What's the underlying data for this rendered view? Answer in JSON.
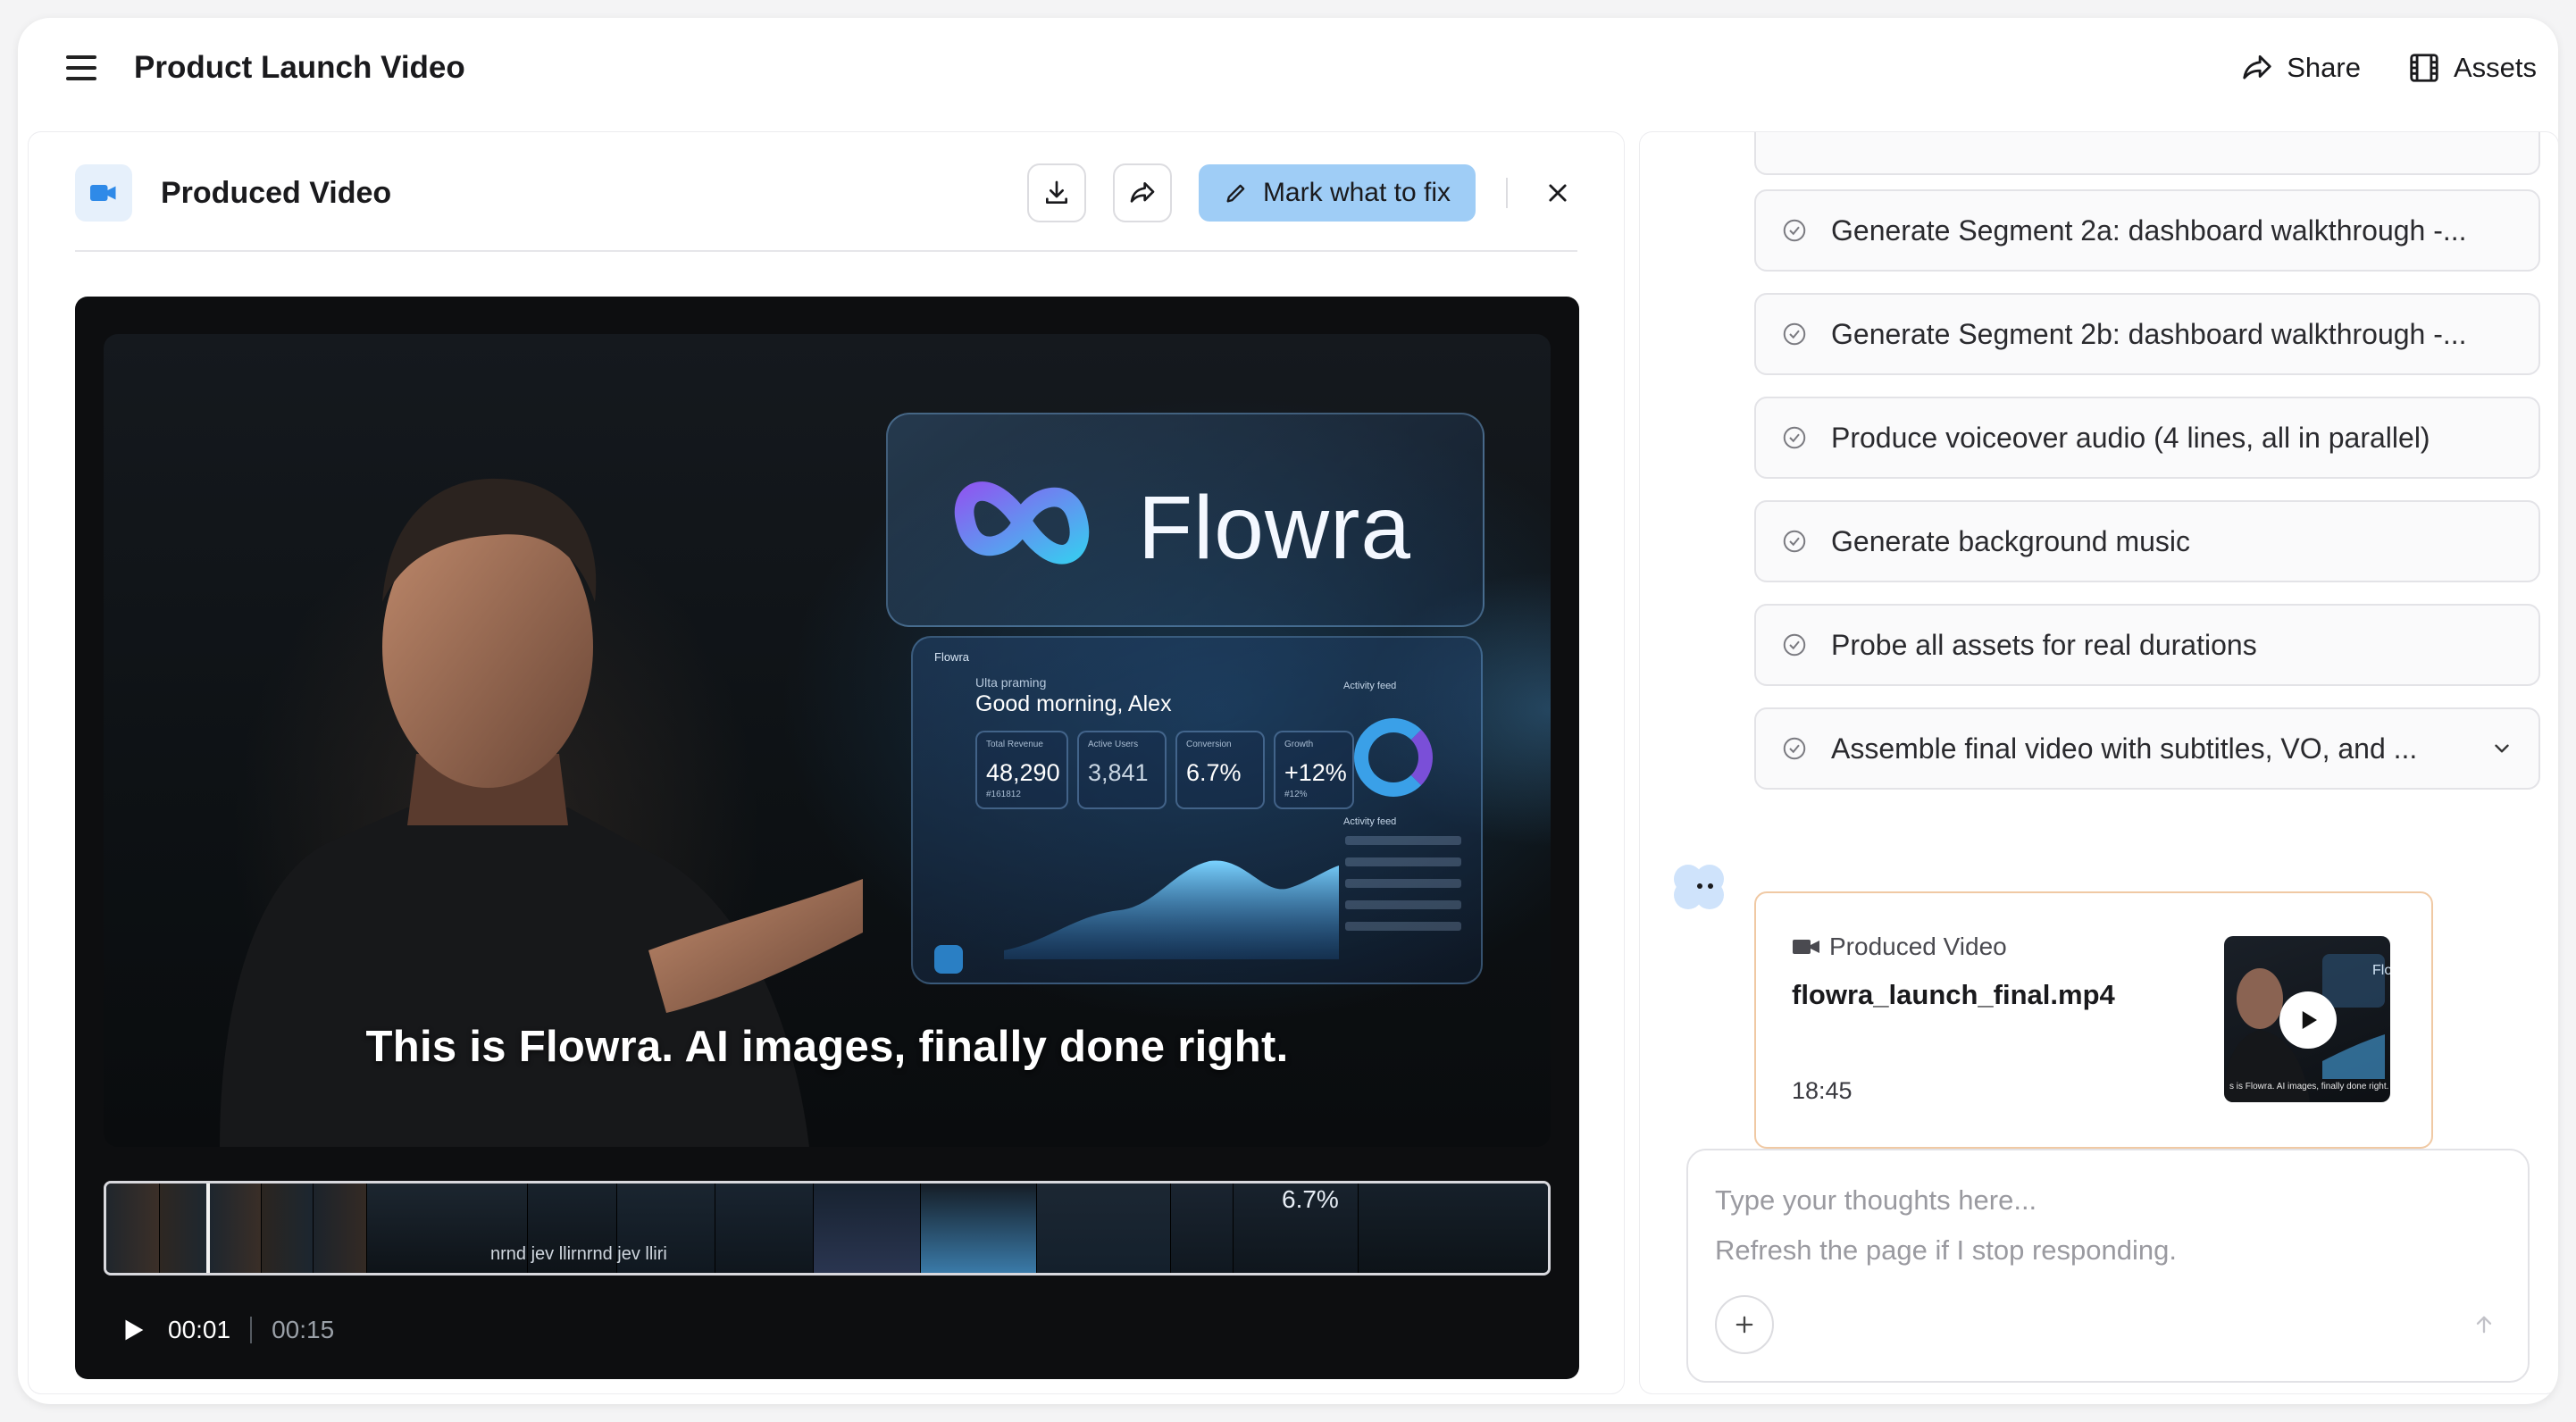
{
  "app": {
    "title": "Product Launch Video",
    "share_label": "Share",
    "assets_label": "Assets"
  },
  "video_panel": {
    "title": "Produced Video",
    "mark_label": "Mark what to fix",
    "frame": {
      "brand": "Flowra",
      "dashboard_brand": "Flowra",
      "greeting_small": "Ulta praming",
      "greeting": "Good morning, Alex",
      "stats": [
        {
          "label": "Total Revenue",
          "value": "48,290",
          "sub": "#161812"
        },
        {
          "label": "Active Users",
          "value": "3,841",
          "sub": ""
        },
        {
          "label": "Conversion",
          "value": "6.7%",
          "sub": ""
        },
        {
          "label": "Growth",
          "value": "+12%",
          "sub": "#12%"
        }
      ],
      "feed_title": "Activity feed",
      "feed_title2": "Activity feed",
      "subtitle": "This is Flowra. AI images, finally done right."
    },
    "filmstrip": {
      "label_big": "6.7%",
      "label_caption": "nrnd jev llirnrnd jev lliri"
    },
    "time_current": "00:01",
    "time_total": "00:15"
  },
  "steps": [
    {
      "label": "Generate Segment 2a: dashboard walkthrough -..."
    },
    {
      "label": "Generate Segment 2b: dashboard walkthrough -..."
    },
    {
      "label": "Produce voiceover audio (4 lines, all in parallel)"
    },
    {
      "label": "Generate background music"
    },
    {
      "label": "Probe all assets for real durations"
    },
    {
      "label": "Assemble final video with subtitles, VO, and ..."
    }
  ],
  "result_card": {
    "kind": "Produced Video",
    "filename": "flowra_launch_final.mp4",
    "duration": "18:45",
    "thumb_caption": "s is Flowra. AI images, finally done right.",
    "thumb_brand": "Flo"
  },
  "composer": {
    "placeholder": "Type your thoughts here...\nRefresh the page if I stop responding."
  },
  "colors": {
    "accent_button": "#9fcdf6",
    "card_border": "#f0c9a4",
    "video_icon": "#2f8ae8"
  }
}
